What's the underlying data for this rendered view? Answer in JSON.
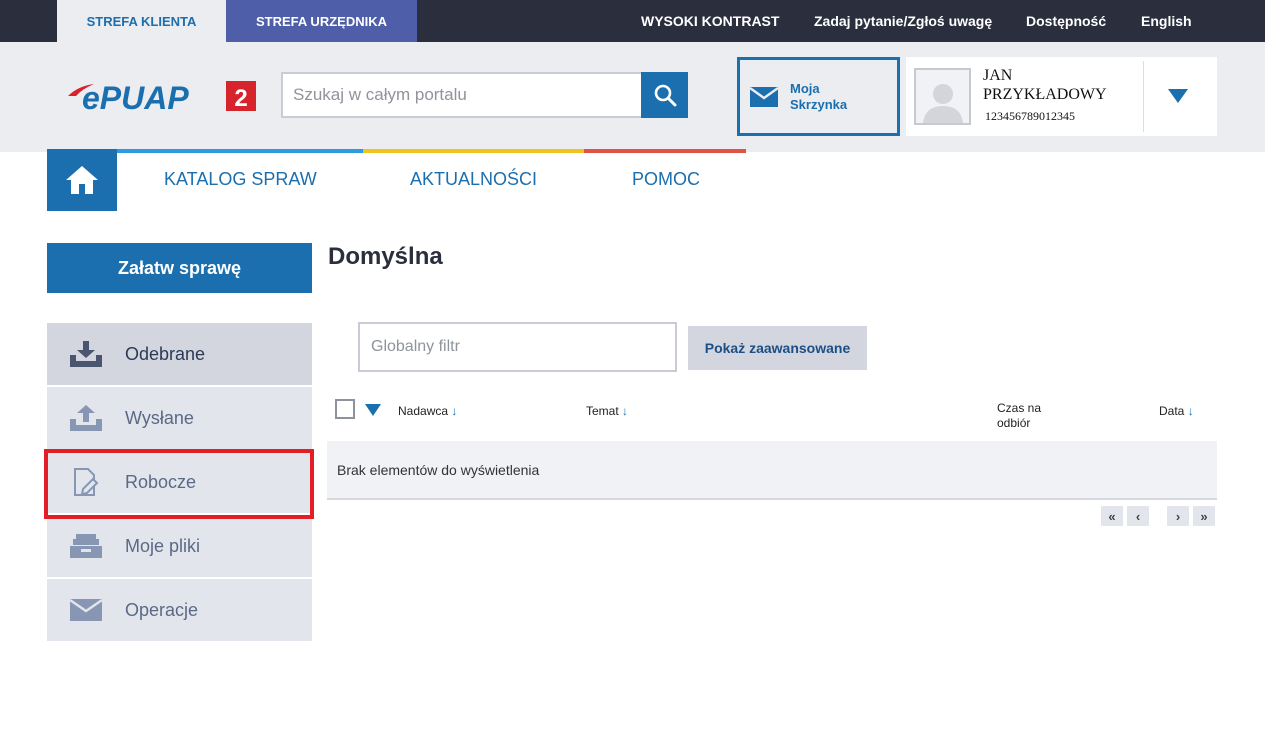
{
  "topbar": {
    "tab_klient": "STREFA KLIENTA",
    "tab_urzednik": "STREFA URZĘDNIKA",
    "high_contrast": "WYSOKI KONTRAST",
    "ask": "Zadaj pytanie/Zgłoś uwagę",
    "accessibility": "Dostępność",
    "language": "English"
  },
  "header": {
    "logo_text": "ePUAP",
    "logo_version": "2",
    "search_placeholder": "Szukaj w całym portalu",
    "inbox_label_line1": "Moja",
    "inbox_label_line2": "Skrzynka",
    "user_first_name": "JAN",
    "user_last_name": "PRZYKŁADOWY",
    "user_id": "123456789012345"
  },
  "nav": {
    "items": [
      {
        "label": "KATALOG SPRAW"
      },
      {
        "label": "AKTUALNOŚCI"
      },
      {
        "label": "POMOC"
      }
    ]
  },
  "colors": {
    "accent": "#1b6fae",
    "stripe_blue": "#2c9be0",
    "stripe_yellow": "#f0c420",
    "stripe_red": "#e05344",
    "highlight": "#e21e26"
  },
  "sidebar": {
    "primary_button": "Załatw sprawę",
    "items": [
      {
        "label": "Odebrane",
        "icon": "download-tray-icon",
        "active": true
      },
      {
        "label": "Wysłane",
        "icon": "upload-tray-icon",
        "active": false
      },
      {
        "label": "Robocze",
        "icon": "edit-document-icon",
        "active": false
      },
      {
        "label": "Moje pliki",
        "icon": "file-drawer-icon",
        "active": false
      },
      {
        "label": "Operacje",
        "icon": "envelope-icon",
        "active": false
      }
    ]
  },
  "main": {
    "title": "Domyślna",
    "filter_placeholder": "Globalny filtr",
    "advanced_button": "Pokaż zaawansowane",
    "columns": [
      {
        "label": "Nadawca",
        "sortable": true
      },
      {
        "label": "Temat",
        "sortable": true
      },
      {
        "label": "Czas na odbiór",
        "sortable": false
      },
      {
        "label": "Data",
        "sortable": true
      }
    ],
    "sort_arrow": "↓",
    "empty_message": "Brak elementów do wyświetlenia",
    "pager": {
      "first": "«",
      "prev": "‹",
      "next": "›",
      "last": "»"
    }
  }
}
